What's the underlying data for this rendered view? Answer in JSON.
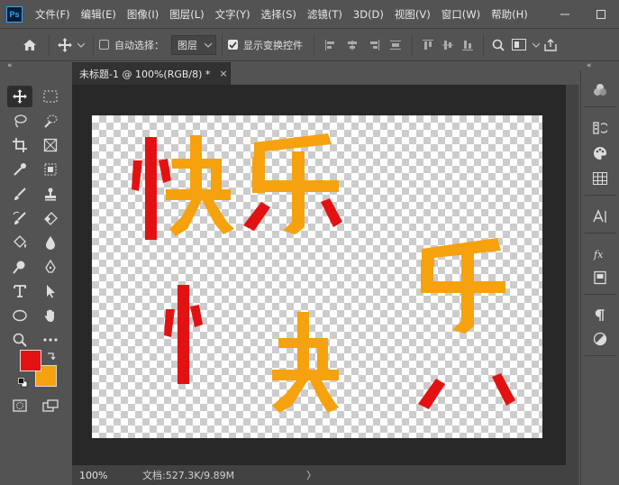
{
  "app": {
    "logo_text": "Ps"
  },
  "menu": {
    "items": [
      "文件(F)",
      "编辑(E)",
      "图像(I)",
      "图层(L)",
      "文字(Y)",
      "选择(S)",
      "滤镜(T)",
      "3D(D)",
      "视图(V)",
      "窗口(W)",
      "帮助(H)"
    ]
  },
  "options": {
    "auto_select_label": "自动选择：",
    "auto_select_checked": false,
    "layer_select_value": "图层",
    "show_transform_label": "显示变换控件",
    "show_transform_checked": true
  },
  "document": {
    "tab_title": "未标题-1 @ 100%(RGB/8) *",
    "tab_close": "×"
  },
  "status": {
    "zoom": "100%",
    "doc_info": "文档:527.3K/9.89M",
    "arrow": "〉"
  },
  "colors": {
    "foreground": "#e31212",
    "background": "#f5a20e",
    "red_text": "#e31212",
    "orange_text": "#f5a20e"
  },
  "canvas_text": {
    "top_left": "快",
    "top_right": "乐",
    "bottom_part1": "忄",
    "bottom_part2": "夬",
    "bottom_part3": "丘",
    "bottom_part4": "八"
  }
}
